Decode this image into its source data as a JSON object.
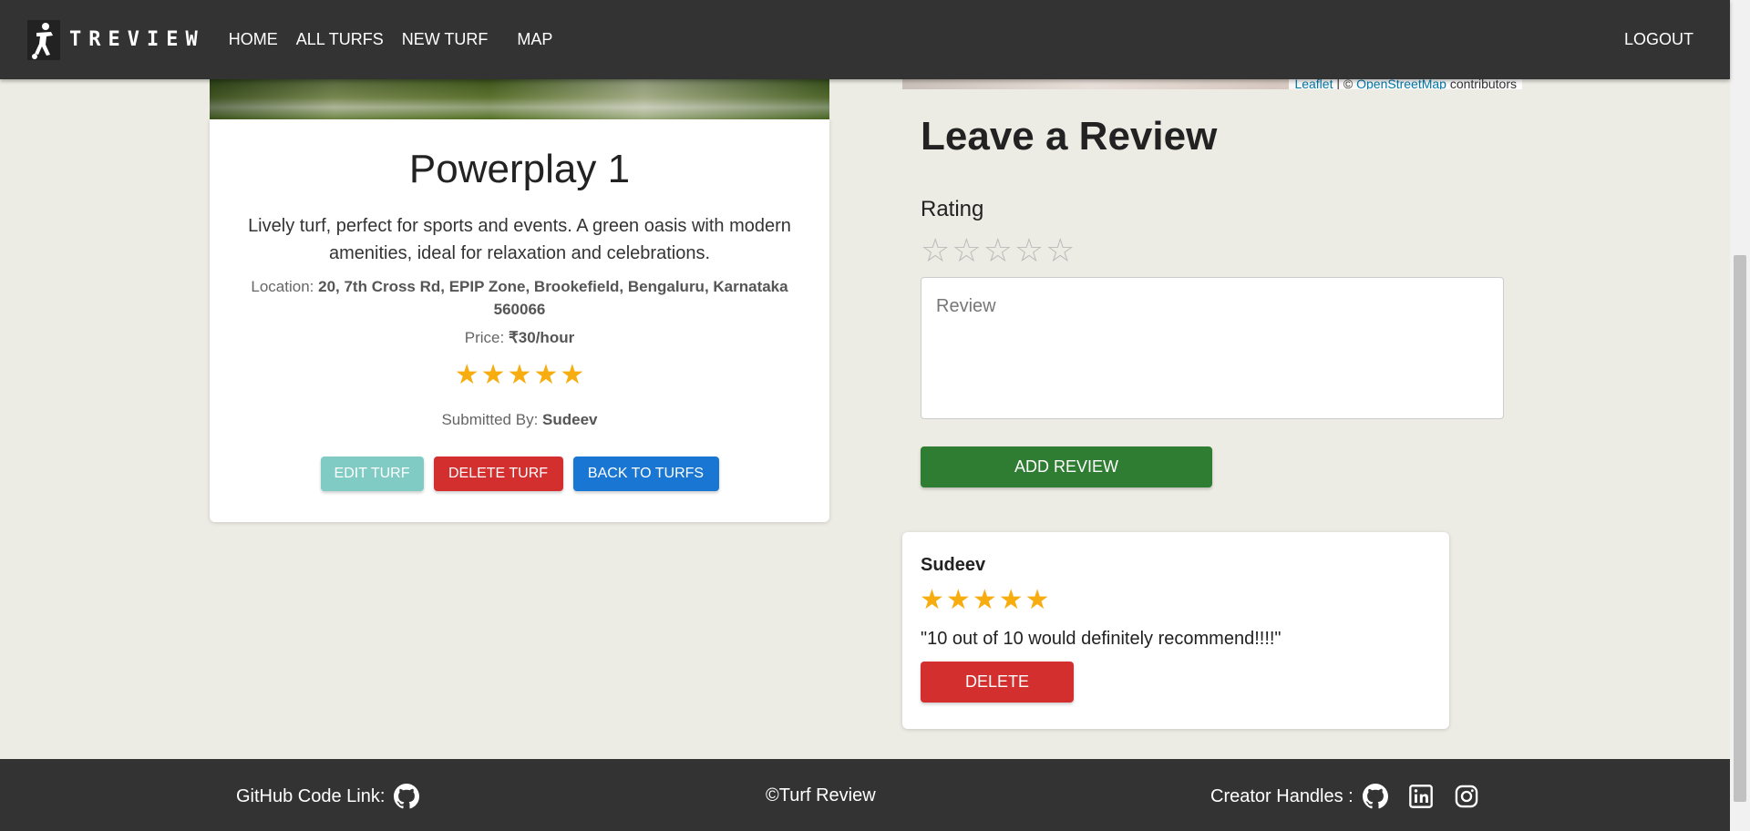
{
  "navbar": {
    "brand": "TREVIEW",
    "links": [
      "HOME",
      "ALL TURFS",
      "NEW TURF",
      "MAP"
    ],
    "logout": "LOGOUT"
  },
  "turf": {
    "name": "Powerplay 1",
    "description": "Lively turf, perfect for sports and events. A green oasis with modern amenities, ideal for relaxation and celebrations.",
    "location_label": "Location:",
    "location": "20, 7th Cross Rd, EPIP Zone, Brookefield, Bengaluru, Karnataka 560066",
    "price_label": "Price:",
    "price": "₹30/hour",
    "rating": 5,
    "submitted_label": "Submitted By:",
    "submitted_by": "Sudeev",
    "buttons": {
      "edit": "EDIT TURF",
      "delete": "DELETE TURF",
      "back": "BACK TO TURFS"
    }
  },
  "map": {
    "attribution_leaflet": "Leaflet",
    "attribution_sep": " | © ",
    "attribution_osm": "OpenStreetMap",
    "attribution_tail": " contributors"
  },
  "review_form": {
    "heading": "Leave a Review",
    "rating_label": "Rating",
    "rating_value": 0,
    "review_placeholder": "Review",
    "submit": "ADD REVIEW"
  },
  "reviews": [
    {
      "author": "Sudeev",
      "rating": 5,
      "text": "\"10 out of 10 would definitely recommend!!!!\"",
      "delete": "DELETE"
    }
  ],
  "footer": {
    "github_label": "GitHub Code Link:",
    "copyright": "©Turf Review",
    "creator_label": "Creator Handles :"
  },
  "colors": {
    "navbar_bg": "#333333",
    "page_bg": "#ecece4",
    "star": "#f7ad0f",
    "edit_btn": "#80cbc4",
    "delete_btn": "#d32f2f",
    "back_btn": "#1976d2",
    "add_review_btn": "#2e7d32"
  }
}
